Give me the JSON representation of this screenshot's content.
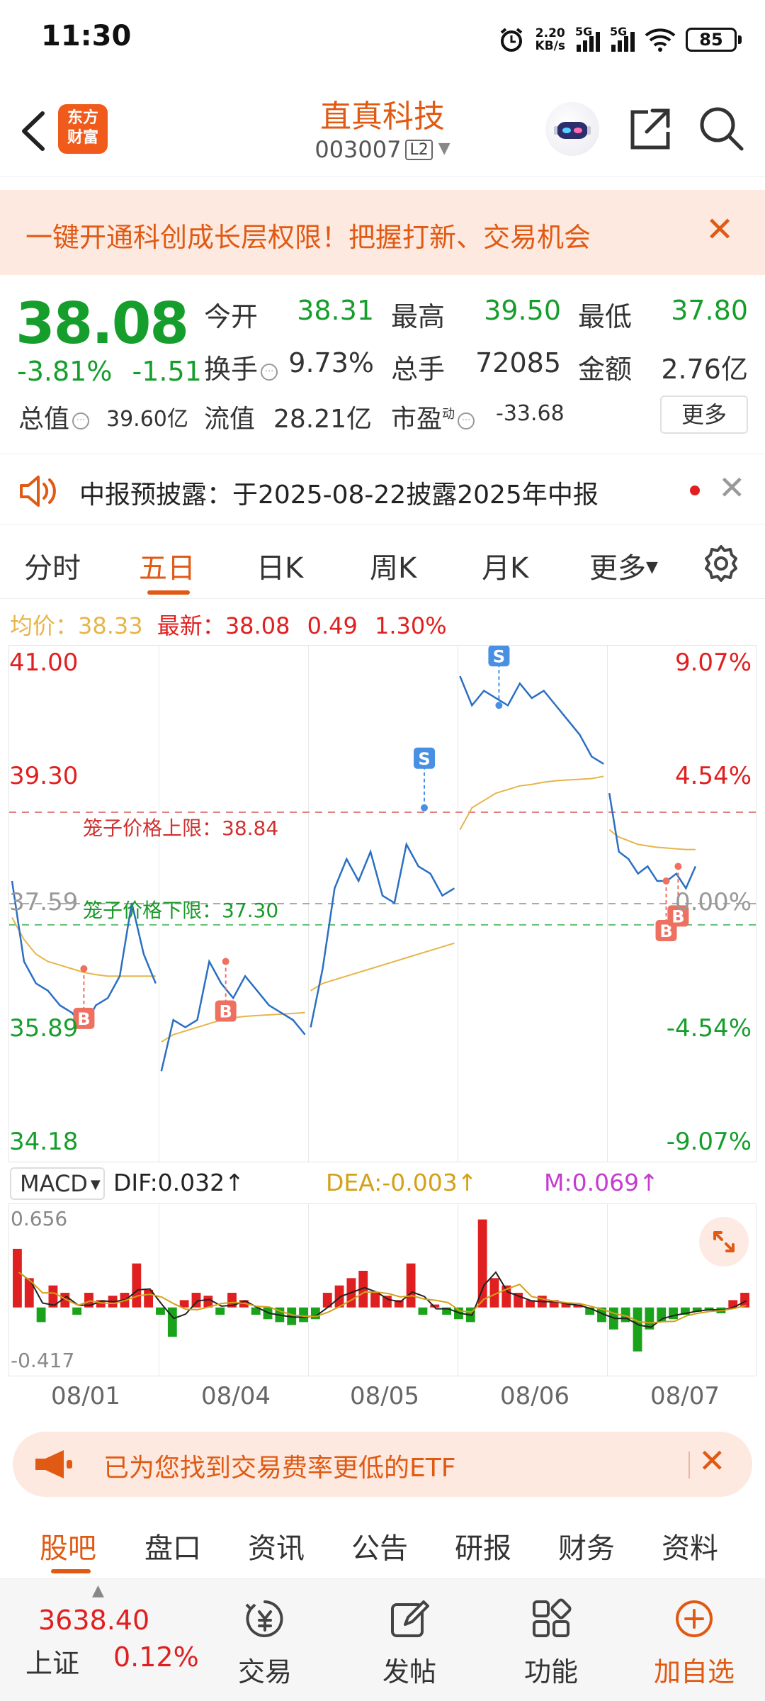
{
  "status_bar": {
    "time": "11:30",
    "net_speed_value": "2.20",
    "net_speed_unit": "KB/s",
    "signal1_label": "5G",
    "signal2_label": "5G",
    "battery": "85"
  },
  "header": {
    "logo_line1": "东方",
    "logo_line2": "财富",
    "stock_name": "直真科技",
    "stock_code": "003007",
    "level_tag": "L2"
  },
  "promo_banner": {
    "text": "一键开通科创成长层权限！把握打新、交易机会"
  },
  "quote": {
    "price": "38.08",
    "change_pct": "-3.81%",
    "change_abs": "-1.51",
    "open_label": "今开",
    "open_value": "38.31",
    "high_label": "最高",
    "high_value": "39.50",
    "low_label": "最低",
    "low_value": "37.80",
    "turnover_label": "换手",
    "turnover_value": "9.73%",
    "volume_label": "总手",
    "volume_value": "72085",
    "amount_label": "金额",
    "amount_value": "2.76亿",
    "mktcap_label": "总值",
    "mktcap_value": "39.60亿",
    "float_label": "流值",
    "float_value": "28.21亿",
    "pe_label": "市盈",
    "pe_superscript": "动",
    "pe_value": "-33.68",
    "more_label": "更多"
  },
  "notice": {
    "text": "中报预披露：于2025-08-22披露2025年中报"
  },
  "chart_tabs": [
    "分时",
    "五日",
    "日K",
    "周K",
    "月K",
    "更多"
  ],
  "active_chart_tab": "五日",
  "price_line": {
    "avg_label": "均价：",
    "avg_value": "38.33",
    "latest_label": "最新：",
    "latest_value": "38.08",
    "latest_change": "0.49",
    "latest_pct": "1.30%"
  },
  "chart_data": {
    "type": "line",
    "y_axis_left": [
      "41.00",
      "39.30",
      "37.59",
      "35.89",
      "34.18"
    ],
    "y_axis_right": [
      "9.07%",
      "4.54%",
      "0.00%",
      "-4.54%",
      "-9.07%"
    ],
    "ylim": [
      34.18,
      41.0
    ],
    "prev_close": 37.59,
    "days": [
      "08/01",
      "08/04",
      "08/05",
      "08/06",
      "08/07"
    ],
    "cage_upper_label": "笼子价格上限：38.84",
    "cage_upper": 38.84,
    "cage_lower_label": "笼子价格下限：37.30",
    "cage_lower": 37.3,
    "series": [
      {
        "name": "price",
        "values": [
          [
            37.9,
            36.8,
            36.5,
            36.4,
            36.2,
            36.1,
            35.9,
            36.2,
            36.3,
            36.6,
            37.6,
            36.9,
            36.5
          ],
          [
            35.3,
            36.0,
            35.9,
            36.0,
            36.8,
            36.5,
            36.3,
            36.6,
            36.4,
            36.2,
            36.1,
            36.0,
            35.8
          ],
          [
            35.9,
            36.7,
            37.8,
            38.2,
            37.9,
            38.3,
            37.7,
            37.6,
            38.4,
            38.1,
            38.0,
            37.7,
            37.8
          ],
          [
            40.7,
            40.3,
            40.5,
            40.4,
            40.3,
            40.6,
            40.4,
            40.5,
            40.3,
            40.1,
            39.9,
            39.6,
            39.5
          ],
          [
            39.1,
            38.3,
            38.2,
            38.0,
            38.1,
            37.9,
            37.9,
            38.0,
            37.8,
            38.1
          ]
        ]
      },
      {
        "name": "avg",
        "values": [
          [
            37.4,
            37.1,
            36.9,
            36.8,
            36.75,
            36.7,
            36.65,
            36.62,
            36.6,
            36.6,
            36.6,
            36.6,
            36.6
          ],
          [
            35.7,
            35.8,
            35.85,
            35.9,
            35.95,
            36.0,
            36.03,
            36.05,
            36.06,
            36.07,
            36.08,
            36.09,
            36.1
          ],
          [
            36.4,
            36.5,
            36.55,
            36.6,
            36.65,
            36.7,
            36.75,
            36.8,
            36.85,
            36.9,
            36.95,
            37.0,
            37.05
          ],
          [
            38.6,
            38.9,
            39.0,
            39.1,
            39.15,
            39.2,
            39.22,
            39.25,
            39.27,
            39.28,
            39.29,
            39.3,
            39.33
          ],
          [
            38.6,
            38.5,
            38.45,
            38.4,
            38.38,
            38.36,
            38.35,
            38.34,
            38.33,
            38.33
          ]
        ]
      }
    ],
    "trade_markers": [
      {
        "label": "B",
        "day": 0,
        "price": 36.7
      },
      {
        "label": "B",
        "day": 1,
        "price": 36.8
      },
      {
        "label": "S",
        "day": 2,
        "price": 38.9
      },
      {
        "label": "S",
        "day": 3,
        "price": 40.3
      },
      {
        "label": "B",
        "day": 4,
        "price": 37.9
      },
      {
        "label": "B",
        "day": 4,
        "price": 38.1
      }
    ]
  },
  "macd": {
    "selector": "MACD",
    "dif_label": "DIF:0.032↑",
    "dea_label": "DEA:-0.003↑",
    "m_label": "M:0.069↑",
    "y_max": "0.656",
    "y_min": "-0.417",
    "bars": [
      0.4,
      0.2,
      -0.1,
      0.15,
      0.1,
      -0.05,
      0.1,
      0.05,
      0.08,
      0.1,
      0.3,
      0.12,
      -0.05,
      -0.2,
      0.05,
      0.1,
      0.08,
      -0.05,
      0.1,
      0.05,
      -0.05,
      -0.08,
      -0.1,
      -0.12,
      -0.1,
      -0.08,
      0.1,
      0.15,
      0.2,
      0.25,
      0.1,
      0.08,
      0.05,
      0.3,
      -0.05,
      0.02,
      -0.05,
      -0.08,
      -0.1,
      0.6,
      0.2,
      0.15,
      0.1,
      0.05,
      0.08,
      0.05,
      0.03,
      0.02,
      -0.05,
      -0.1,
      -0.15,
      -0.1,
      -0.3,
      -0.15,
      -0.1,
      -0.08,
      -0.05,
      -0.03,
      -0.02,
      -0.04,
      0.05,
      0.1
    ],
    "colors": {
      "up": "#e02020",
      "down": "#1aa31a",
      "dif": "#222222",
      "dea": "#d4a017"
    }
  },
  "etf_banner": {
    "text": "已为您找到交易费率更低的ETF"
  },
  "sub_tabs": [
    "股吧",
    "盘口",
    "资讯",
    "公告",
    "研报",
    "财务",
    "资料"
  ],
  "active_sub_tab": "股吧",
  "bottom_bar": {
    "index_value": "3638.40",
    "index_name": "上证",
    "index_change": "0.12%",
    "nav": [
      "交易",
      "发帖",
      "功能",
      "加自选"
    ]
  },
  "colors": {
    "accent": "#e05a13",
    "up_red": "#e02020",
    "down_green": "#159e2c",
    "avg_line": "#e6b54a",
    "price_line": "#2b6fc2"
  }
}
